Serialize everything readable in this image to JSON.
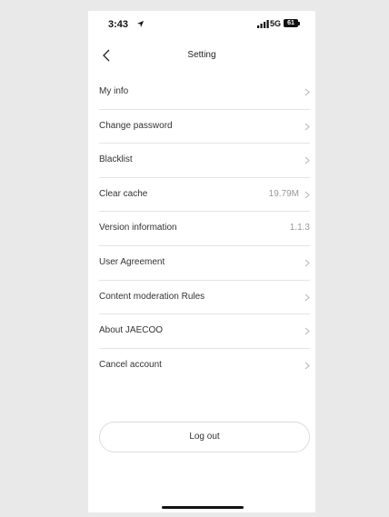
{
  "status_bar": {
    "time": "3:43",
    "network": "5G",
    "battery": "61"
  },
  "nav": {
    "title": "Setting"
  },
  "settings": {
    "items": [
      {
        "label": "My info",
        "value": "",
        "chevron": true
      },
      {
        "label": "Change password",
        "value": "",
        "chevron": true
      },
      {
        "label": "Blacklist",
        "value": "",
        "chevron": true
      },
      {
        "label": "Clear cache",
        "value": "19.79M",
        "chevron": true
      },
      {
        "label": "Version information",
        "value": "1.1.3",
        "chevron": false
      },
      {
        "label": "User Agreement",
        "value": "",
        "chevron": true
      },
      {
        "label": "Content moderation Rules",
        "value": "",
        "chevron": true
      },
      {
        "label": "About JAECOO",
        "value": "",
        "chevron": true
      },
      {
        "label": "Cancel account",
        "value": "",
        "chevron": true
      }
    ]
  },
  "logout": {
    "label": "Log out"
  },
  "icons": {
    "back": "chevron-left-icon",
    "chevron": "chevron-right-icon",
    "location": "location-arrow-icon",
    "signal": "signal-bars-icon",
    "battery": "battery-icon"
  },
  "colors": {
    "background": "#ffffff",
    "divider": "#e4e4e4",
    "text": "#333333",
    "muted": "#9a9a9a"
  }
}
